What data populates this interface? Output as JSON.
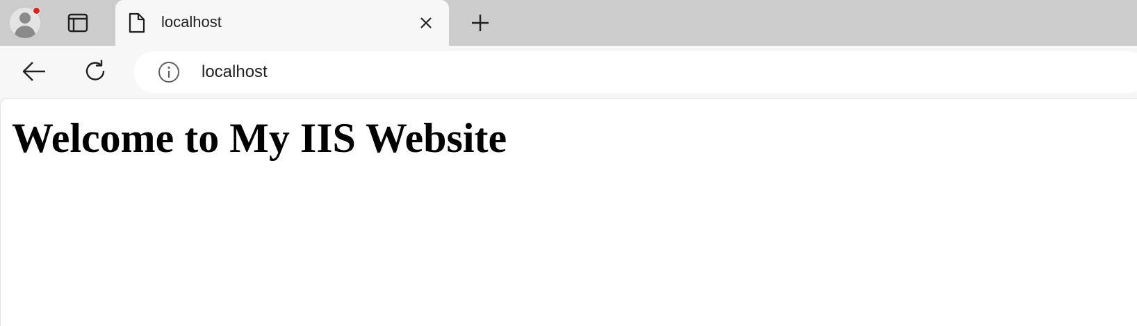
{
  "browser": {
    "tab": {
      "title": "localhost"
    },
    "address_bar": {
      "url": "localhost"
    },
    "icons": {
      "profile": "profile-avatar-icon",
      "tab_actions": "tab-actions-icon",
      "page": "document-icon",
      "close": "close-icon",
      "new_tab": "plus-icon",
      "back": "back-arrow-icon",
      "reload": "reload-icon",
      "site_info": "info-icon"
    },
    "colors": {
      "notification_dot": "#d9261c"
    }
  },
  "page": {
    "heading": "Welcome to My IIS Website"
  }
}
